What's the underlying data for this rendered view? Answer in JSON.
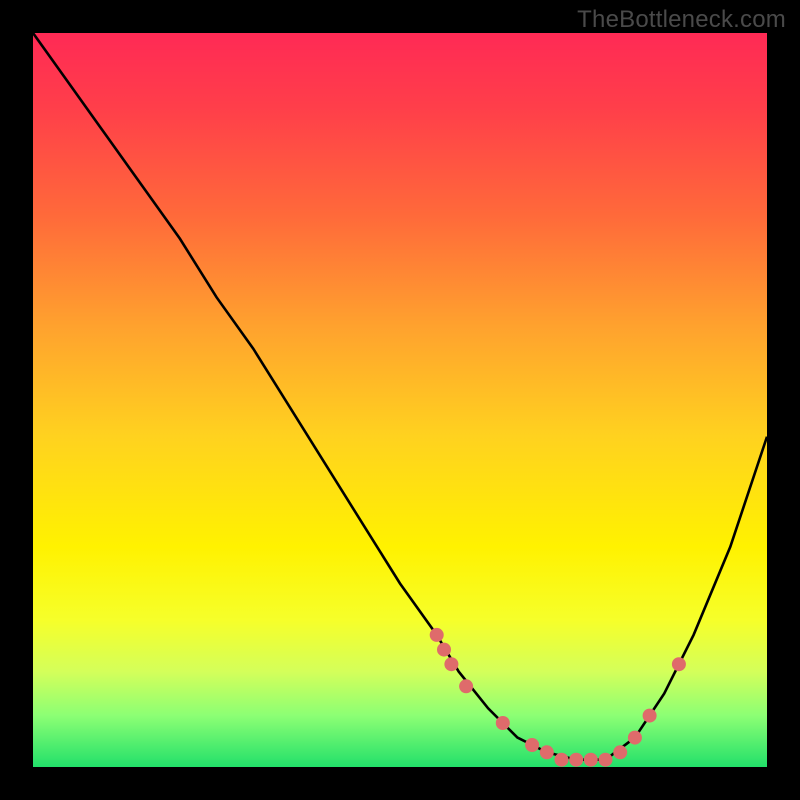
{
  "watermark": "TheBottleneck.com",
  "chart_data": {
    "type": "line",
    "title": "",
    "xlabel": "",
    "ylabel": "",
    "xlim": [
      0,
      100
    ],
    "ylim": [
      0,
      100
    ],
    "series": [
      {
        "name": "bottleneck-curve",
        "x": [
          0,
          5,
          10,
          15,
          20,
          25,
          30,
          35,
          40,
          45,
          50,
          55,
          58,
          62,
          66,
          70,
          74,
          78,
          82,
          86,
          90,
          95,
          100
        ],
        "y": [
          100,
          93,
          86,
          79,
          72,
          64,
          57,
          49,
          41,
          33,
          25,
          18,
          13,
          8,
          4,
          2,
          1,
          1,
          4,
          10,
          18,
          30,
          45
        ]
      }
    ],
    "markers": {
      "name": "highlight-dots",
      "color": "#e06a6a",
      "x": [
        55,
        56,
        57,
        59,
        64,
        68,
        70,
        72,
        74,
        76,
        78,
        80,
        82,
        84,
        88
      ],
      "y": [
        18,
        16,
        14,
        11,
        6,
        3,
        2,
        1,
        1,
        1,
        1,
        2,
        4,
        7,
        14
      ]
    }
  }
}
